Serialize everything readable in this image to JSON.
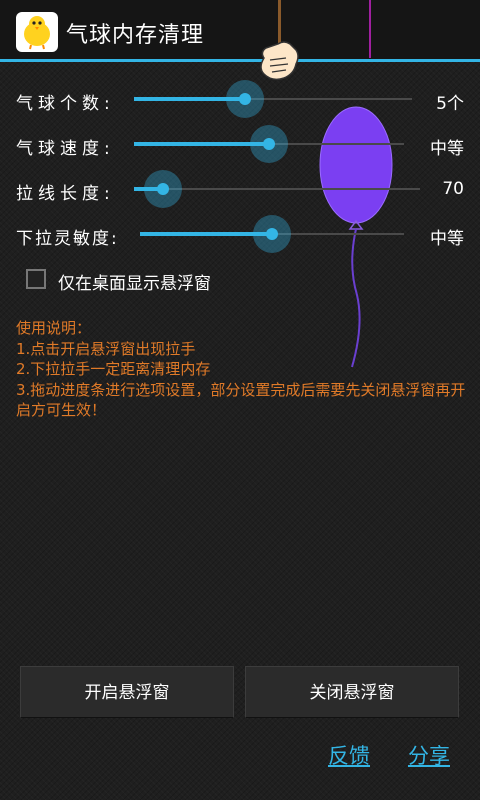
{
  "app": {
    "title": "气球内存清理",
    "icon": "yellow-chick-icon"
  },
  "settings": [
    {
      "label": "气球个数:",
      "value": "5个",
      "level": 0.4
    },
    {
      "label": "气球速度:",
      "value": "中等",
      "level": 0.5
    },
    {
      "label": "拉线长度:",
      "value": "70",
      "level": 0.1
    },
    {
      "label": "下拉灵敏度:",
      "value": "中等",
      "level": 0.5
    }
  ],
  "checkbox": {
    "label": "仅在桌面显示悬浮窗",
    "checked": false
  },
  "instructions": {
    "heading": "使用说明：",
    "lines": [
      "1.点击开启悬浮窗出现拉手",
      "2.下拉拉手一定距离清理内存",
      "3.拖动进度条进行选项设置，部分设置完成后需要先关闭悬浮窗再开启方可生效！"
    ]
  },
  "buttons": {
    "open": "开启悬浮窗",
    "close": "关闭悬浮窗"
  },
  "links": {
    "feedback": "反馈",
    "share": "分享"
  },
  "colors": {
    "accent": "#33b5e5",
    "instruction_text": "#e07a28",
    "balloon": "#7b3ff2",
    "string": "#a020a0"
  }
}
